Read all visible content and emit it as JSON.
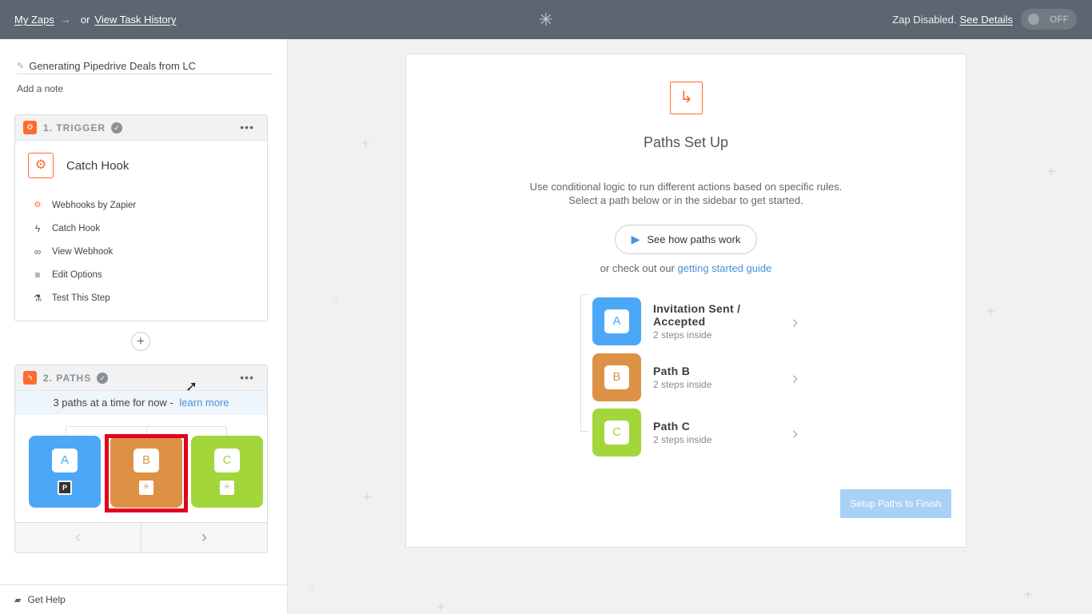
{
  "topbar": {
    "my_zaps": "My Zaps",
    "arrow": "→",
    "or": "or",
    "task_history": "View Task History",
    "status_text": "Zap Disabled.",
    "see_details": "See Details",
    "toggle_label": "OFF",
    "logo_glyph": "✳"
  },
  "sidebar": {
    "zap_name": "Generating Pipedrive Deals from LC",
    "add_note": "Add a note",
    "trigger": {
      "title": "1. TRIGGER",
      "app_name": "Catch Hook",
      "menu": [
        {
          "label": "Webhooks by Zapier",
          "icon": "webhook-icon"
        },
        {
          "label": "Catch Hook",
          "icon": "bolt-icon"
        },
        {
          "label": "View Webhook",
          "icon": "link-icon"
        },
        {
          "label": "Edit Options",
          "icon": "lines-icon"
        },
        {
          "label": "Test This Step",
          "icon": "flask-icon"
        }
      ]
    },
    "add_step": "+",
    "paths": {
      "title": "2. PATHS",
      "note": "3 paths at a time for now -",
      "learn_more": "learn more",
      "tiles": [
        {
          "letter": "A",
          "sub": "P",
          "color": "#4ca8f6"
        },
        {
          "letter": "B",
          "sub": "✳",
          "color": "#dd9145"
        },
        {
          "letter": "C",
          "sub": "✳",
          "color": "#a2d63b"
        }
      ],
      "prev": "‹",
      "next": "›"
    },
    "get_help": "Get Help"
  },
  "main": {
    "title": "Paths Set Up",
    "desc_line1": "Use conditional logic to run different actions based on specific rules.",
    "desc_line2": "Select a path below or in the sidebar to get started.",
    "how_button": "See how paths work",
    "guide_prefix": "or check out our",
    "guide_link": "getting started guide",
    "paths": [
      {
        "letter": "A",
        "name_line1": "Invitation Sent /",
        "name_line2": "Accepted",
        "steps": "2 steps inside",
        "color": "#4ca8f6"
      },
      {
        "letter": "B",
        "name_line1": "Path B",
        "name_line2": "",
        "steps": "2 steps inside",
        "color": "#dd9145"
      },
      {
        "letter": "C",
        "name_line1": "Path C",
        "name_line2": "",
        "steps": "2 steps inside",
        "color": "#a2d63b"
      }
    ],
    "finish_button": "Setup Paths to Finish"
  }
}
